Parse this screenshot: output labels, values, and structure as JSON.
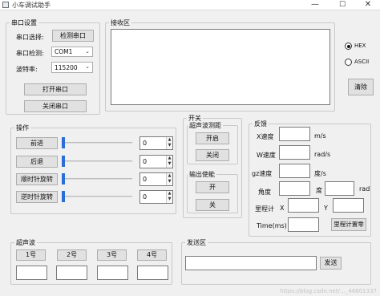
{
  "window": {
    "title": "小车调试助手",
    "min": "—",
    "max": "☐",
    "close": "✕"
  },
  "serial": {
    "group_title": "串口设置",
    "select_label": "串口选择:",
    "detect_button": "检测串口",
    "check_label": "串口检测:",
    "port_value": "COM1",
    "baud_label": "波特率:",
    "baud_value": "115200",
    "open_button": "打开串口",
    "close_button": "关闭串口"
  },
  "receive": {
    "group_title": "接收区",
    "hex_label": "HEX",
    "ascii_label": "ASCII",
    "hex_selected": true,
    "clear_button": "清除"
  },
  "operate": {
    "group_title": "操作",
    "rows": [
      {
        "label": "前进",
        "value": "0"
      },
      {
        "label": "后退",
        "value": "0"
      },
      {
        "label": "顺时针旋转",
        "value": "0"
      },
      {
        "label": "逆时针旋转",
        "value": "0"
      }
    ]
  },
  "switch": {
    "group_title": "开关",
    "ultra_title": "超声波测距",
    "ultra_on": "开启",
    "ultra_off": "关闭",
    "output_title": "输出使能",
    "output_on": "开",
    "output_off": "关"
  },
  "feedback": {
    "group_title": "反馈",
    "x_speed_label": "X速度",
    "x_speed_unit": "m/s",
    "w_speed_label": "W速度",
    "w_speed_unit": "rad/s",
    "gz_speed_label": "gz速度",
    "gz_speed_unit": "度/s",
    "angle_label": "角度",
    "angle_unit_deg": "度",
    "angle_unit_rad": "rad",
    "odom_label": "里程计",
    "x_label": "X",
    "y_label": "Y",
    "time_label": "Time(ms)",
    "odom_reset_button": "里程计置零"
  },
  "ultrasonic": {
    "group_title": "超声波",
    "buttons": [
      "1号",
      "2号",
      "3号",
      "4号"
    ]
  },
  "send": {
    "group_title": "发送区",
    "send_button": "发送"
  },
  "watermark": "https://blog.csdn.net/…_46601337"
}
